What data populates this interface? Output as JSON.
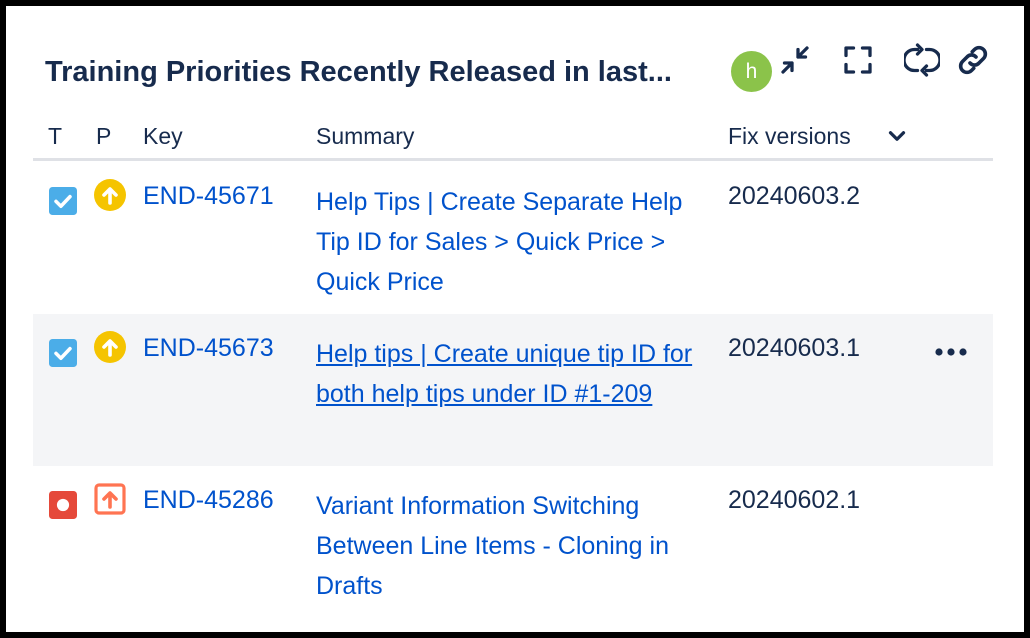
{
  "gadget": {
    "title": "Training Priorities Recently Released in last...",
    "avatar_initial": "h",
    "toolbar_icons": [
      "collapse-icon",
      "fullscreen-icon",
      "refresh-icon",
      "link-icon"
    ]
  },
  "table": {
    "columns": {
      "type": "T",
      "priority": "P",
      "key": "Key",
      "summary": "Summary",
      "fix_versions": "Fix versions"
    },
    "rows": [
      {
        "type": "task",
        "priority": "medium-high",
        "key": "END-45671",
        "summary": "Help Tips | Create Separate Help Tip ID for Sales > Quick Price > Quick Price",
        "fix_version": "20240603.2"
      },
      {
        "type": "task",
        "priority": "medium-high",
        "key": "END-45673",
        "summary": "Help tips | Create unique tip ID for both help tips under ID #1-209",
        "fix_version": "20240603.1"
      },
      {
        "type": "bug",
        "priority": "high",
        "key": "END-45286",
        "summary": "Variant Information Switching Between Line Items - Cloning in Drafts",
        "fix_version": "20240602.1"
      }
    ]
  },
  "colors": {
    "link": "#0052cc",
    "text": "#172b4d",
    "task_icon": "#4bade8",
    "bug_icon": "#e5493a",
    "priority_medium_high": "#f5c400",
    "priority_high": "#ff7452",
    "avatar": "#8bc34a",
    "row_hover": "#f4f5f7"
  }
}
